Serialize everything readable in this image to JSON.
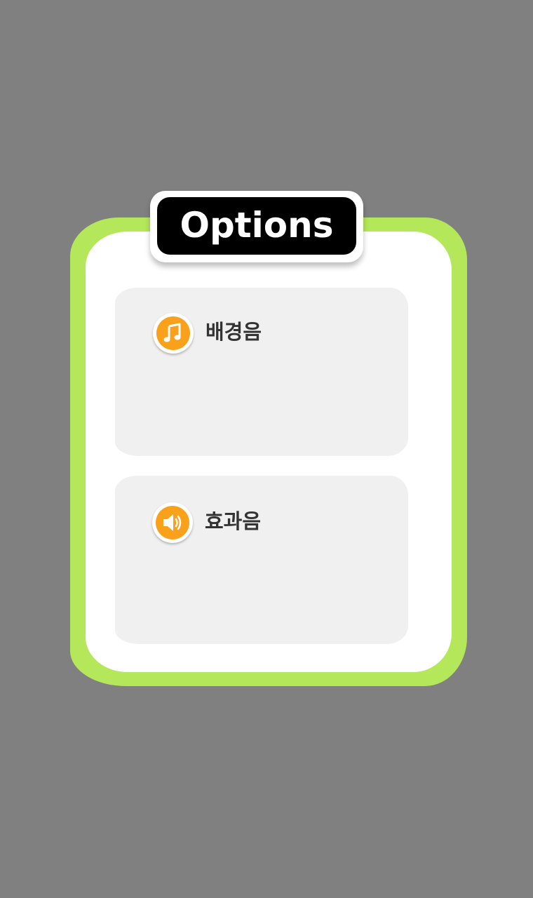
{
  "dialog": {
    "title": "Options"
  },
  "settings": [
    {
      "label": "배경음",
      "icon": "music-note-icon"
    },
    {
      "label": "효과음",
      "icon": "speaker-icon"
    }
  ],
  "colors": {
    "background": "#808080",
    "panel_border": "#b4e85a",
    "panel_fill": "#ffffff",
    "title_bg": "#000000",
    "title_text": "#ffffff",
    "card_fill": "#f0f0f0",
    "icon_accent": "#f9a11b",
    "label_text": "#333333"
  }
}
